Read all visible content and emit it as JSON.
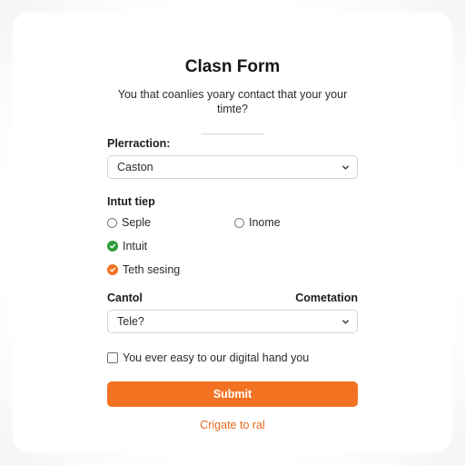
{
  "form": {
    "title": "Clasn Form",
    "subtitle": "You that coanlies yoary contact that your your timte?"
  },
  "field_preferences": {
    "label": "Plerraction:",
    "selected_value": "Caston"
  },
  "input_type": {
    "label": "Intut tiep",
    "options": [
      {
        "label": "Seple",
        "state": "unchecked"
      },
      {
        "label": "Inome",
        "state": "unchecked"
      },
      {
        "label": "Intuit",
        "state": "checked"
      },
      {
        "label": "Teth sesing",
        "state": "checked"
      }
    ]
  },
  "contact": {
    "label_left": "Cantol",
    "label_right": "Cometation",
    "selected_value": "Tele?"
  },
  "consent": {
    "label": "You ever easy to our digital hand you",
    "checked": false
  },
  "submit": {
    "label": "Submit"
  },
  "footer_link": {
    "label": "Crigate to ral"
  },
  "colors": {
    "accent": "#f27222",
    "link": "#e26a1f",
    "check_green": "#2e9e3a",
    "check_orange": "#f27222"
  },
  "icons": {
    "select_chevron": "chevron-down-icon",
    "checked_green": "check-circle-icon",
    "checked_orange": "check-circle-icon"
  }
}
